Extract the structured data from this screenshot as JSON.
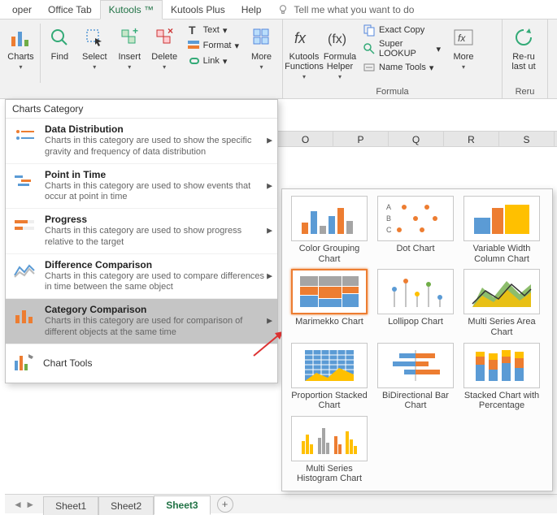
{
  "tabs": {
    "items": [
      "oper",
      "Office Tab",
      "Kutools ™",
      "Kutools Plus",
      "Help"
    ],
    "active_index": 2,
    "tell_me": "Tell me what you want to do"
  },
  "ribbon": {
    "charts": "Charts",
    "find": "Find",
    "select": "Select",
    "insert": "Insert",
    "delete": "Delete",
    "text": "Text",
    "format": "Format",
    "link": "Link",
    "more": "More",
    "kutools_functions": "Kutools Functions",
    "formula_helper": "Formula Helper",
    "exact_copy": "Exact Copy",
    "super_lookup": "Super LOOKUP",
    "name_tools": "Name Tools",
    "more2": "More",
    "rerun": "Re-ru",
    "rerun_desc": "last ut",
    "group_formula": "Formula",
    "group_rerun": "Reru"
  },
  "columns": [
    "O",
    "P",
    "Q",
    "R",
    "S"
  ],
  "dropdown": {
    "header": "Charts Category",
    "items": [
      {
        "title": "Data Distribution",
        "desc": "Charts in this category are used to show the specific gravity and frequency of data distribution"
      },
      {
        "title": "Point in Time",
        "desc": "Charts in this category are used to show events that occur at point in time"
      },
      {
        "title": "Progress",
        "desc": "Charts in this category are used to show progress relative to the target"
      },
      {
        "title": "Difference Comparison",
        "desc": "Charts in this category are used to compare differences in time between the same object"
      },
      {
        "title": "Category Comparison",
        "desc": "Charts in this category are used for comparison of different objects at the same time"
      }
    ],
    "active_index": 4,
    "tools": "Chart Tools"
  },
  "gallery": [
    "Color Grouping Chart",
    "Dot Chart",
    "Variable Width Column Chart",
    "Marimekko Chart",
    "Lollipop Chart",
    "Multi Series Area Chart",
    "Proportion Stacked Chart",
    "BiDirectional Bar Chart",
    "Stacked Chart with Percentage",
    "Multi Series Histogram Chart"
  ],
  "gallery_selected_index": 3,
  "sheets": {
    "items": [
      "Sheet1",
      "Sheet2",
      "Sheet3"
    ],
    "active_index": 2
  }
}
